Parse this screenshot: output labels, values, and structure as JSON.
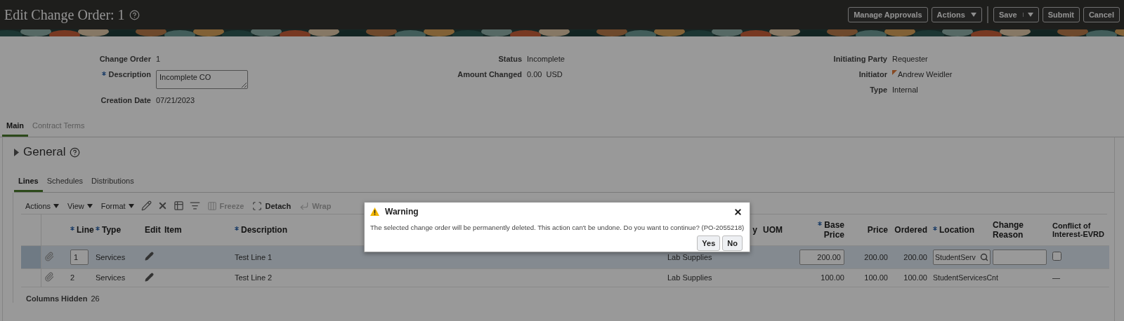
{
  "header": {
    "title": "Edit Change Order: 1",
    "buttons": [
      {
        "label": "Manage Approvals",
        "kind": "plain"
      },
      {
        "label": "Actions",
        "kind": "menu"
      },
      {
        "label": "Save",
        "kind": "split"
      },
      {
        "label": "Submit",
        "kind": "plain"
      },
      {
        "label": "Cancel",
        "kind": "plain"
      }
    ]
  },
  "summary": [
    [
      {
        "label": "Change Order",
        "value": "1",
        "kind": "text"
      },
      {
        "label": "Description",
        "value": "Incomplete CO",
        "kind": "textarea",
        "required": true
      },
      {
        "label": "Creation Date",
        "value": "07/21/2023",
        "kind": "text"
      }
    ],
    [
      {
        "label": "Status",
        "value": "Incomplete",
        "kind": "text"
      },
      {
        "label": "Amount Changed",
        "value": "0.00",
        "unit": "USD",
        "kind": "amount"
      }
    ],
    [
      {
        "label": "Initiating Party",
        "value": "Requester",
        "kind": "text"
      },
      {
        "label": "Initiator",
        "value": "Andrew Weidler",
        "kind": "person"
      },
      {
        "label": "Type",
        "value": "Internal",
        "kind": "text"
      }
    ]
  ],
  "tabs": [
    {
      "label": "Main",
      "selected": true
    },
    {
      "label": "Contract Terms",
      "selected": false
    }
  ],
  "section": {
    "title": "General",
    "expanded": false
  },
  "subtabs": [
    {
      "label": "Lines",
      "selected": true
    },
    {
      "label": "Schedules",
      "selected": false
    },
    {
      "label": "Distributions",
      "selected": false
    }
  ],
  "toolbar": [
    {
      "kind": "menu",
      "label": "Actions"
    },
    {
      "kind": "menu",
      "label": "View"
    },
    {
      "kind": "menu",
      "label": "Format"
    },
    {
      "kind": "icon"
    },
    {
      "kind": "icon"
    },
    {
      "kind": "icon"
    },
    {
      "kind": "icon"
    },
    {
      "kind": "labeled",
      "label": "Freeze",
      "disabled": true
    },
    {
      "kind": "labeled",
      "label": "Detach",
      "disabled": false
    },
    {
      "kind": "labeled",
      "label": "Wrap",
      "disabled": true
    }
  ],
  "table": {
    "columns": [
      {
        "label": "Line",
        "required": true
      },
      {
        "label": "Type",
        "required": true
      },
      {
        "label": "Edit",
        "required": false
      },
      {
        "label": "Item",
        "required": false
      },
      {
        "label": "Description",
        "required": true
      },
      {
        "label": "y"
      },
      {
        "label": "UOM",
        "required": false
      },
      {
        "label": "Base Price",
        "required": true
      },
      {
        "label": "Price",
        "required": false
      },
      {
        "label": "Ordered",
        "required": false
      },
      {
        "label": "Location",
        "required": true
      },
      {
        "label": "Change Reason",
        "required": false
      },
      {
        "label": "Conflict of Interest-EVRD",
        "required": false
      }
    ],
    "rows": [
      {
        "selected": true,
        "editable": true,
        "line": "1",
        "type": "Services",
        "description": "Test Line 1",
        "category": "Lab Supplies",
        "base_price": "200.00",
        "price": "200.00",
        "ordered": "200.00",
        "location": "StudentServ",
        "conflict_checked": false
      },
      {
        "selected": false,
        "editable": false,
        "line": "2",
        "type": "Services",
        "description": "Test Line 2",
        "category": "Lab Supplies",
        "base_price": "100.00",
        "price": "100.00",
        "ordered": "100.00",
        "location": "StudentServicesCnt",
        "conflict": "—"
      }
    ],
    "footer": {
      "label": "Columns Hidden",
      "value": "26"
    }
  },
  "dialog": {
    "title": "Warning",
    "message": "The selected change order will be permanently deleted. This action can't be undone. Do you want to continue? (PO-2055218)",
    "buttons": [
      "Yes",
      "No"
    ]
  }
}
